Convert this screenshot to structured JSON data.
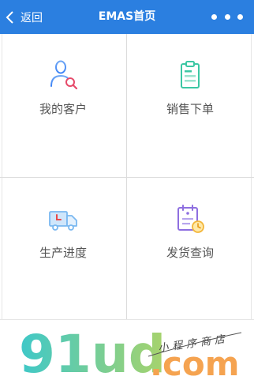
{
  "header": {
    "back_label": "返回",
    "title": "EMAS首页"
  },
  "menu": [
    {
      "label": "我的客户",
      "icon": "customer-search-icon"
    },
    {
      "label": "销售下单",
      "icon": "clipboard-icon"
    },
    {
      "label": "生产进度",
      "icon": "delivery-truck-icon"
    },
    {
      "label": "发货查询",
      "icon": "calendar-clock-icon"
    }
  ],
  "watermark": {
    "brand": "91ud",
    "domain": ".com",
    "tagline": "小程序商店"
  },
  "colors": {
    "header": "#2b7fe0",
    "label": "#555555",
    "brand_gradient_start": "#3ec8c9",
    "brand_gradient_end": "#a8d36b",
    "domain": "#f5a350"
  }
}
